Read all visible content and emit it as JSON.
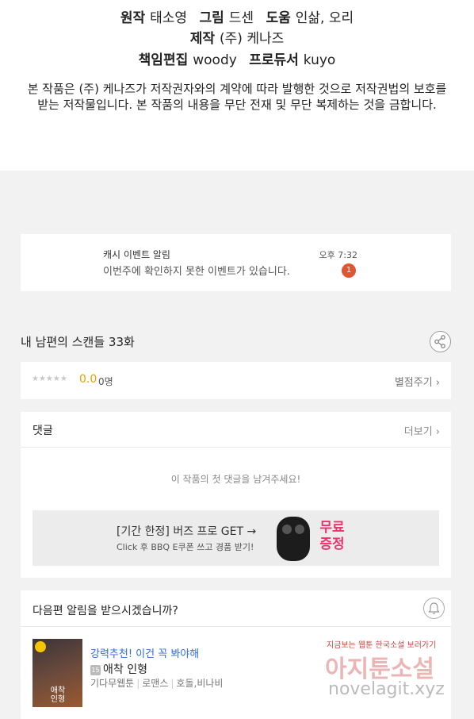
{
  "credits": {
    "line1": {
      "label_a": "원작",
      "value_a": "태소영",
      "label_b": "그림",
      "value_b": "드센",
      "label_c": "도움",
      "value_c": "인삶, 오리"
    },
    "line2": {
      "label": "제작",
      "value": "(주) 케나즈"
    },
    "line3": {
      "label_a": "책임편집",
      "value_a": "woody",
      "label_b": "프로듀서",
      "value_b": "kuyo"
    },
    "copyright_1": "본 작품은 (주) 케나즈가 저작권자와의 계약에 따라 발행한 것으로 저작권법의 보호를",
    "copyright_2": "받는 저작물입니다. 본 작품의 내용을 무단 전재 및 무단 복제하는 것을 금합니다."
  },
  "notification": {
    "title": "캐시 이벤트 알림",
    "body": "이번주에 확인하지 못한 이벤트가 있습니다.",
    "time": "오후 7:32",
    "badge_count": "1"
  },
  "episode": {
    "title": "내 남편의 스캔들 33화",
    "share_icon": "share-icon"
  },
  "rating": {
    "stars": "★★★★★",
    "score": "0.0",
    "people": "0명",
    "rate_link": "별점주기 ›"
  },
  "comments": {
    "title": "댓글",
    "more_link": "더보기 ›",
    "empty_message": "이 작품의 첫 댓글을 남겨주세요!",
    "banner": {
      "headline": "[기간 한정] 버즈 프로 GET →",
      "subtext": "Click 후 BBQ E쿠폰 쓰고 경품 받기!",
      "badge_line1": "무료",
      "badge_line2": "증정"
    }
  },
  "next_episode": {
    "question": "다음편 알림을 받으시겠습니까?",
    "bell_icon": "bell-icon",
    "recommend_label": "강력추천! 이건 꼭 봐야해",
    "age_badge": "15",
    "work_title": "애착 인형",
    "thumb_title": "애착인형",
    "tags": [
      "기다무웹툰",
      "로맨스",
      "호돌,비나비"
    ]
  },
  "watermark": {
    "small_text": "지금보는 웹툰 한국소설 보러가기",
    "big_text": "아지툰소설",
    "url": "novelagit.xyz"
  },
  "colors": {
    "accent_orange": "#e05534",
    "score_gold": "#e0a300",
    "link_blue": "#2e6fd8",
    "badge_pink": "#e8356f"
  }
}
